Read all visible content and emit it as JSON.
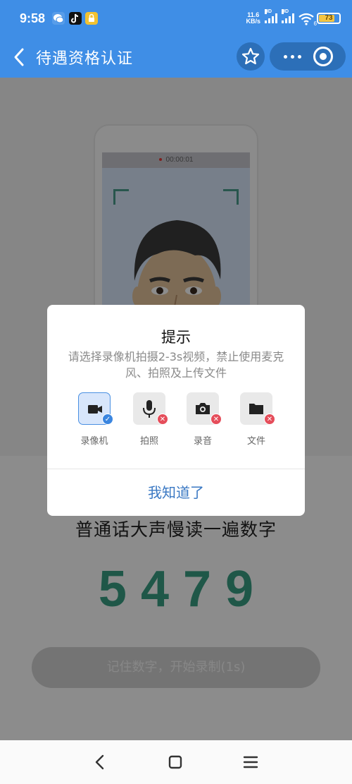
{
  "status_bar": {
    "time": "9:58",
    "net_speed_value": "11.6",
    "net_speed_unit": "KB/s",
    "signal1_label": "HD",
    "signal2_label": "HD",
    "wifi_label": "6",
    "battery": "73",
    "battery_level": 0.73,
    "app_icons": [
      "wechat-icon",
      "tiktok-icon",
      "lock-icon"
    ]
  },
  "header": {
    "title": "待遇资格认证",
    "icons": [
      "back-arrow-icon",
      "star-icon",
      "more-dots-icon",
      "target-circle-icon"
    ],
    "color": "#3f8ee6"
  },
  "preview": {
    "timer": "00:00:01"
  },
  "page": {
    "instruction": "普通话大声慢读一遍数字",
    "digits": "5479",
    "start_button": "记住数字，开始录制(1s)",
    "digit_color": "#3a9e84"
  },
  "dialog": {
    "title": "提示",
    "message": "请选择录像机拍摄2-3s视频，禁止使用麦克风、拍照及上传文件",
    "options": [
      {
        "label": "录像机",
        "icon": "video-camera-icon",
        "selected": true
      },
      {
        "label": "拍照",
        "icon": "microphone-icon",
        "selected": false
      },
      {
        "label": "录音",
        "icon": "camera-icon",
        "selected": false
      },
      {
        "label": "文件",
        "icon": "folder-icon",
        "selected": false
      }
    ],
    "confirm_button": "我知道了",
    "accent": "#3a78c3"
  },
  "nav_bar": {
    "icons": [
      "nav-back-icon",
      "nav-home-icon",
      "nav-menu-icon"
    ]
  }
}
